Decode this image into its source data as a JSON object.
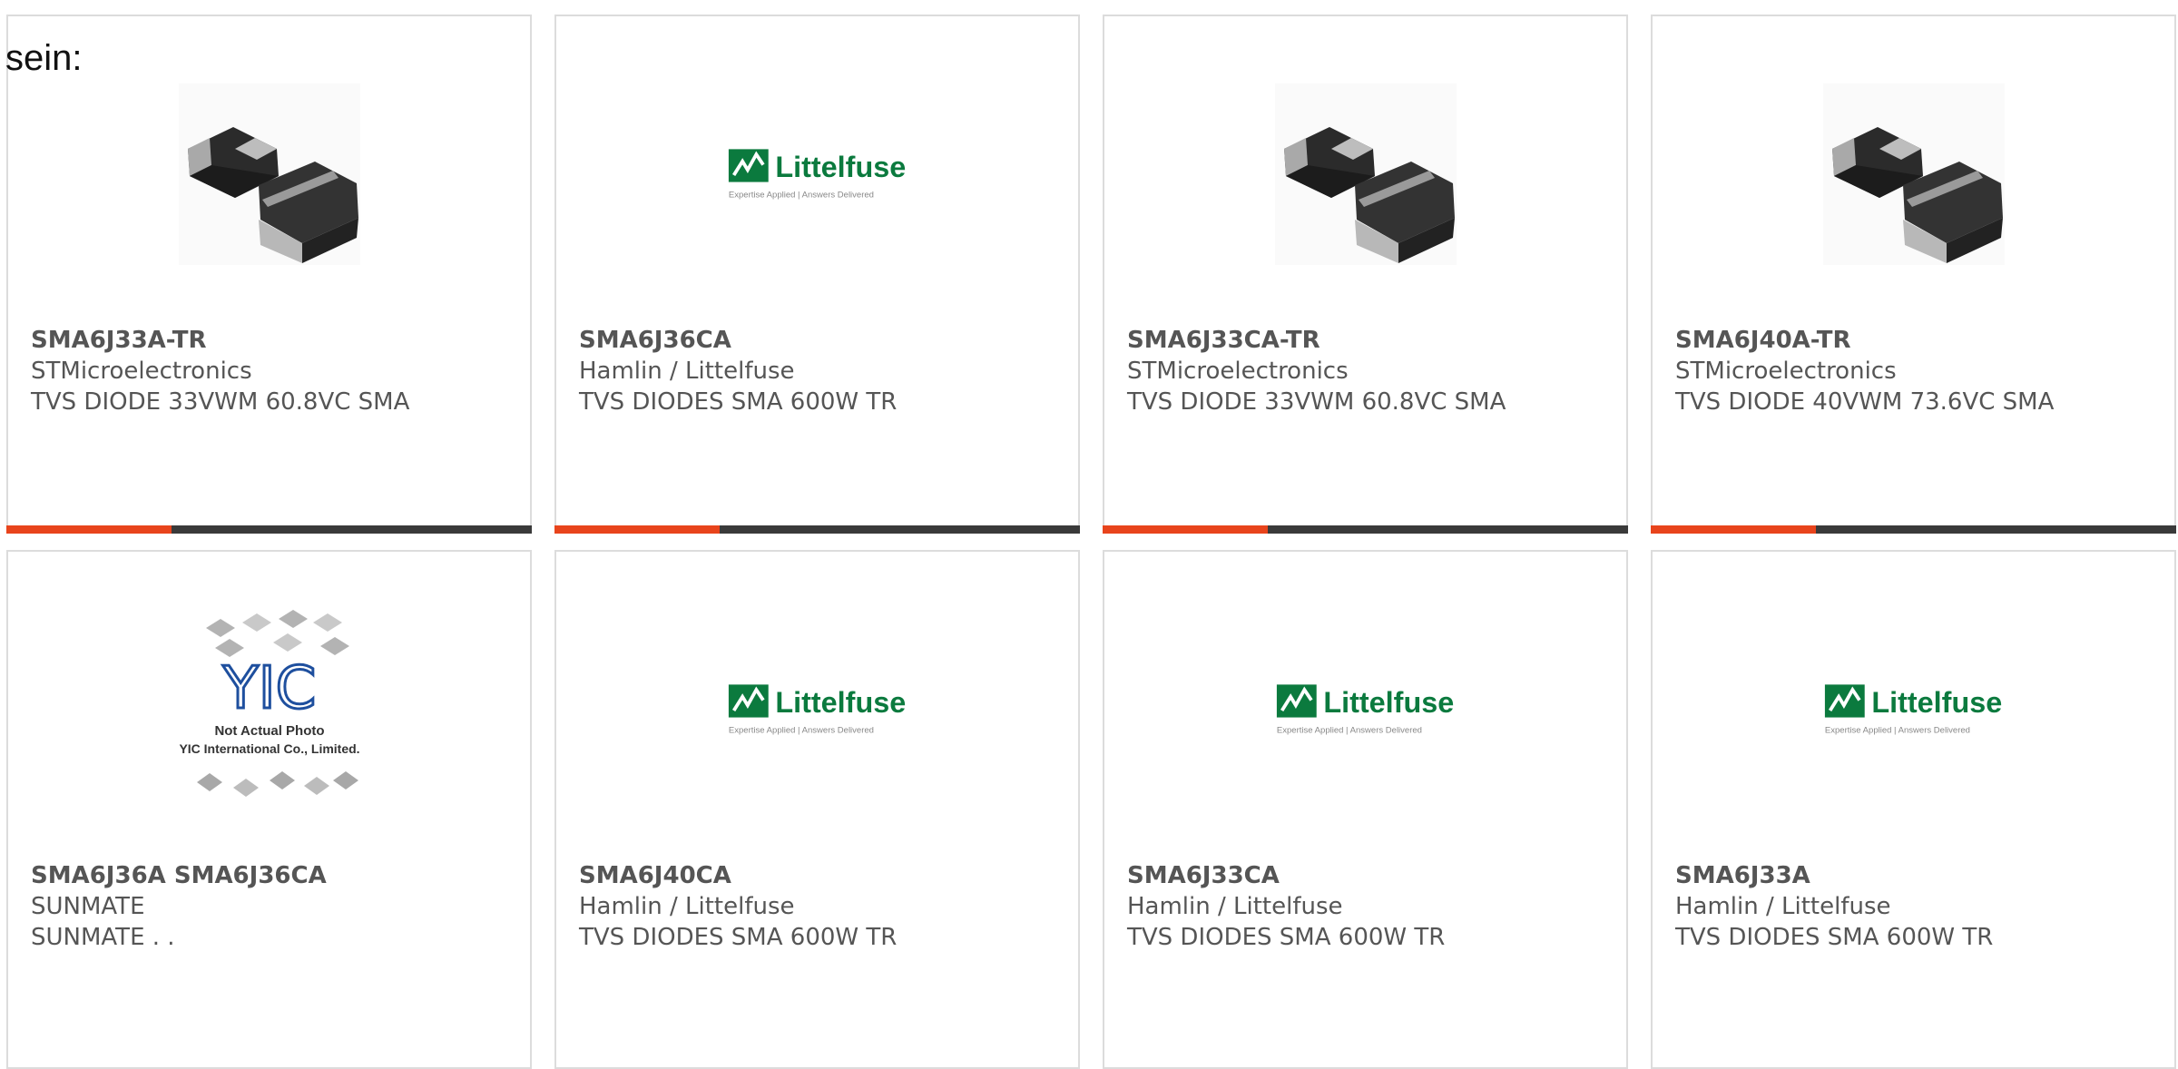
{
  "intro_text": "sein:",
  "accent_color": "#e8441c",
  "bar_color": "#3a3a3a",
  "products": [
    {
      "part": "SMA6J33A-TR",
      "manufacturer": "STMicroelectronics",
      "description": "TVS DIODE 33VWM 60.8VC SMA",
      "image": "sma-diode-photo"
    },
    {
      "part": "SMA6J36CA",
      "manufacturer": "Hamlin / Littelfuse",
      "description": "TVS DIODES SMA 600W TR",
      "image": "littelfuse-logo"
    },
    {
      "part": "SMA6J33CA-TR",
      "manufacturer": "STMicroelectronics",
      "description": "TVS DIODE 33VWM 60.8VC SMA",
      "image": "sma-diode-photo"
    },
    {
      "part": "SMA6J40A-TR",
      "manufacturer": "STMicroelectronics",
      "description": "TVS DIODE 40VWM 73.6VC SMA",
      "image": "sma-diode-photo"
    },
    {
      "part": "SMA6J36A SMA6J36CA",
      "manufacturer": "SUNMATE",
      "description": "SUNMATE . .",
      "image": "yic-placeholder"
    },
    {
      "part": "SMA6J40CA",
      "manufacturer": "Hamlin / Littelfuse",
      "description": "TVS DIODES SMA 600W TR",
      "image": "littelfuse-logo"
    },
    {
      "part": "SMA6J33CA",
      "manufacturer": "Hamlin / Littelfuse",
      "description": "TVS DIODES SMA 600W TR",
      "image": "littelfuse-logo"
    },
    {
      "part": "SMA6J33A",
      "manufacturer": "Hamlin / Littelfuse",
      "description": "TVS DIODES SMA 600W TR",
      "image": "littelfuse-logo"
    }
  ],
  "logo": {
    "brand": "Littelfuse",
    "tagline_left": "Expertise Applied",
    "tagline_right": "Answers Delivered"
  },
  "placeholder": {
    "line1": "Not Actual Photo",
    "line2": "YIC International Co., Limited.",
    "logo_text": "YIC"
  }
}
